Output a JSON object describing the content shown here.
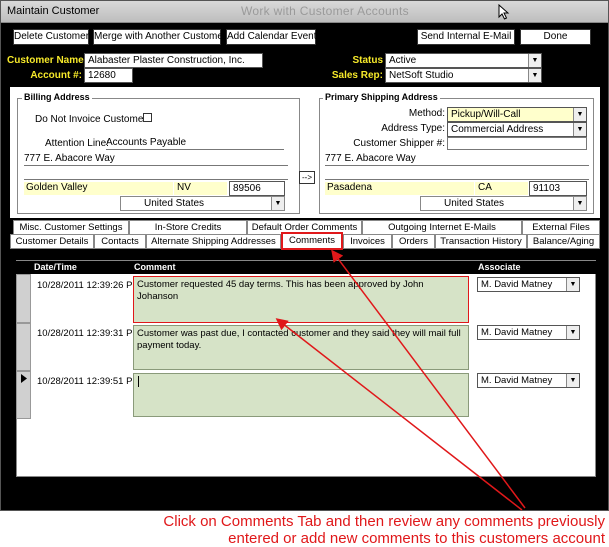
{
  "window": {
    "title": "Maintain Customer",
    "ghost_title": "Work with Customer Accounts"
  },
  "toolbar": {
    "delete_label": "Delete Customer",
    "merge_label": "Merge with Another Customer",
    "calendar_label": "Add Calendar Event",
    "email_label": "Send Internal E-Mail",
    "done_label": "Done"
  },
  "customer": {
    "name_label": "Customer Name:",
    "name": "Alabaster Plaster Construction, Inc.",
    "account_label": "Account #:",
    "account": "12680",
    "status_label": "Status",
    "status": "Active",
    "rep_label": "Sales Rep:",
    "rep": "NetSoft Studio"
  },
  "billing": {
    "title": "Billing Address",
    "do_not_invoice_label": "Do Not Invoice Customer?",
    "attention_label": "Attention Line:",
    "attention": "Accounts Payable",
    "street1": "777 E. Abacore Way",
    "city": "Golden Valley",
    "state": "NV",
    "zip": "89506",
    "country": "United States"
  },
  "copy_arrow": "-->",
  "shipping": {
    "title": "Primary Shipping Address",
    "method_label": "Method:",
    "method": "Pickup/Will-Call",
    "addr_type_label": "Address Type:",
    "addr_type": "Commercial Address",
    "shipper_label": "Customer Shipper #:",
    "street1": "777 E. Abacore Way",
    "city": "Pasadena",
    "state": "CA",
    "zip": "91103",
    "country": "United States"
  },
  "tabs_row1": [
    "Misc. Customer Settings",
    "In-Store Credits",
    "Default Order Comments",
    "Outgoing Internet E-Mails",
    "External Files"
  ],
  "tabs_row2": [
    "Customer Details",
    "Contacts",
    "Alternate Shipping Addresses",
    "Comments",
    "Invoices",
    "Orders",
    "Transaction History",
    "Balance/Aging"
  ],
  "grid": {
    "col_datetime": "Date/Time",
    "col_comment": "Comment",
    "col_associate": "Associate",
    "rows": [
      {
        "datetime": "10/28/2011 12:39:26 PM",
        "comment": "Customer requested 45 day terms.  This has been approved by John Johanson",
        "associate": "M. David Matney"
      },
      {
        "datetime": "10/28/2011 12:39:31 PM",
        "comment": "Customer was past due, I contacted customer and they said they will mail full payment today.",
        "associate": "M. David Matney"
      },
      {
        "datetime": "10/28/2011 12:39:51 PM",
        "comment": "",
        "associate": "M. David Matney"
      }
    ]
  },
  "annotation": {
    "line1": "Click on Comments Tab and then review any comments previously",
    "line2": "entered or add new comments to this customers account",
    "color": "#e0181a"
  }
}
